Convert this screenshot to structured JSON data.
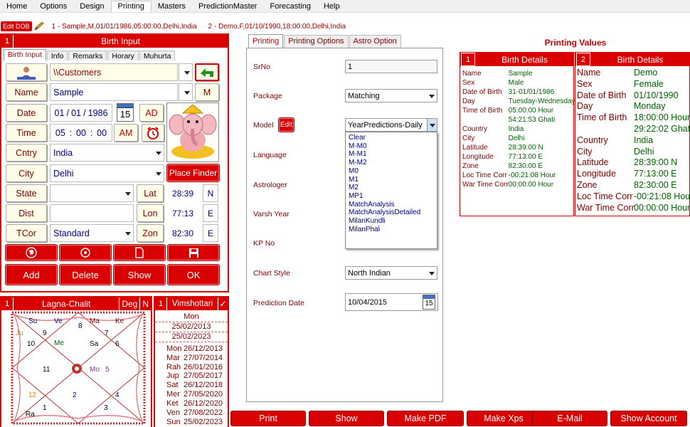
{
  "menu": [
    "Home",
    "Options",
    "Design",
    "Printing",
    "Masters",
    "PredictionMaster",
    "Forecasting",
    "Help"
  ],
  "dob": {
    "edit_label": "Edit DOB",
    "entry1": "1 - Sample,M,01/01/1986,05:00:00,Delhi,India",
    "entry2": "2 - Demo,F,01/10/1990,18:00:00,Delhi,India"
  },
  "birth": {
    "num": "1",
    "title": "Birth Input",
    "tabs": [
      "Birth Input",
      "Info",
      "Remarks",
      "Horary",
      "Muhurta"
    ],
    "path": "\\\\Customers",
    "name_label": "Name",
    "name": "Sample",
    "gender": "M",
    "date_label": "Date",
    "date_d": "01",
    "date_m": "01",
    "date_y": "1986",
    "cal_num": "15",
    "ad": "AD",
    "time_label": "Time",
    "time_h": "05",
    "time_m": "00",
    "time_s": "00",
    "am": "AM",
    "cntry_label": "Cntry",
    "country": "India",
    "city_label": "City",
    "city": "Delhi",
    "place_finder": "Place Finder",
    "state_label": "State",
    "lat_label": "Lat",
    "lat": "28:39",
    "lat_dir": "N",
    "dist_label": "Dist",
    "lon_label": "Lon",
    "lon": "77:13",
    "lon_dir": "E",
    "tcor_label": "TCor",
    "tcor": "Standard",
    "zon_label": "Zon",
    "zon": "82:30",
    "zon_dir": "E",
    "add": "Add",
    "delete": "Delete",
    "show": "Show",
    "ok": "OK"
  },
  "lagna": {
    "num": "1",
    "title": "Lagna-Chalit",
    "deg": "Deg",
    "n": "N",
    "planets": [
      {
        "t": "Su",
        "c": "#000080"
      },
      {
        "t": "Ve",
        "c": "#000080"
      },
      {
        "t": "Ma",
        "c": "#800000"
      },
      {
        "t": "Ke",
        "c": "#800000"
      },
      {
        "t": "Ju",
        "c": "#d09000"
      },
      {
        "t": "Me",
        "c": "#006400"
      },
      {
        "t": "Sa",
        "c": "#000000"
      },
      {
        "t": "Mo",
        "c": "#9030a0"
      },
      {
        "t": "Ra",
        "c": "#000000"
      }
    ],
    "houses": [
      "9",
      "8",
      "7",
      "10",
      "6",
      "11",
      "5",
      "12",
      "2",
      "4",
      "1",
      "3"
    ]
  },
  "vim": {
    "num": "1",
    "title": "Vimshottari",
    "head": "Mon",
    "d1": "25/02/2013",
    "d2": "25/02/2023",
    "rows": [
      {
        "p": "Mon",
        "d": "26/12/2013"
      },
      {
        "p": "Mar",
        "d": "27/07/2014"
      },
      {
        "p": "Rah",
        "d": "26/01/2016"
      },
      {
        "p": "Jup",
        "d": "27/05/2017"
      },
      {
        "p": "Sat",
        "d": "26/12/2018"
      },
      {
        "p": "Mer",
        "d": "27/05/2020"
      },
      {
        "p": "Ket",
        "d": "26/12/2020"
      },
      {
        "p": "Ven",
        "d": "27/08/2022"
      },
      {
        "p": "Sun",
        "d": "25/02/2023"
      }
    ]
  },
  "printing": {
    "tabs": [
      "Printing",
      "Printing Options",
      "Astro Option"
    ],
    "srno_label": "SrNo",
    "srno": "1",
    "package_label": "Package",
    "package": "Matching",
    "model_label": "Model",
    "edit": "Edit",
    "model": "YearPredictions-Daily",
    "options": [
      "Clear",
      "M-M0",
      "M-M1",
      "M-M2",
      "M0",
      "M1",
      "M2",
      "MP1",
      "MatchAnalysis",
      "MatchAnalysisDetailed",
      "MilanKundli",
      "MilanPhal"
    ],
    "language_label": "Language",
    "astrologer_label": "Astrologer",
    "varsh_label": "Varsh Year",
    "kp_label": "KP No",
    "chart_label": "Chart Style",
    "chart_style": "North Indian",
    "pred_label": "Prediction Date",
    "pred_date": "10/04/2015",
    "cal_num": "15"
  },
  "values": {
    "title": "Printing Values",
    "p1": {
      "num": "1",
      "title": "Birth Details",
      "labels": [
        "Name",
        "Sex",
        "Date of Birth",
        "Day",
        "Time of Birth",
        "",
        "Country",
        "City",
        "Latitude",
        "Longitude",
        "Zone",
        "Loc Time Corr",
        "War Time Corr"
      ],
      "vals": [
        "Sample",
        "Male",
        "31-01/01/1986",
        "Tuesday-Wednesday",
        "05:00:00 Hour",
        "54:21:53 Ghati",
        "India",
        "Delhi",
        "28:39:00 N",
        "77:13:00 E",
        "82:30:00 E",
        "-00:21:08 Hour",
        "00:00:00 Hour"
      ]
    },
    "p2": {
      "num": "2",
      "title": "Birth Details",
      "labels": [
        "Name",
        "Sex",
        "Date of Birth",
        "Day",
        "Time of Birth",
        "",
        "Country",
        "City",
        "Latitude",
        "Longitude",
        "Zone",
        "Loc Time Corr",
        "War Time Corr"
      ],
      "vals": [
        "Demo",
        "Female",
        "01/10/1990",
        "Monday",
        "18:00:00 Hour",
        "29:22:02 Ghati",
        "India",
        "Delhi",
        "28:39:00 N",
        "77:13:00 E",
        "82:30:00 E",
        "-00:21:08 Hour",
        "00:00:00 Hour"
      ]
    }
  },
  "bottom": [
    "Print",
    "Show",
    "Make PDF",
    "Make Xps",
    "E-Mail",
    "Show Account"
  ]
}
